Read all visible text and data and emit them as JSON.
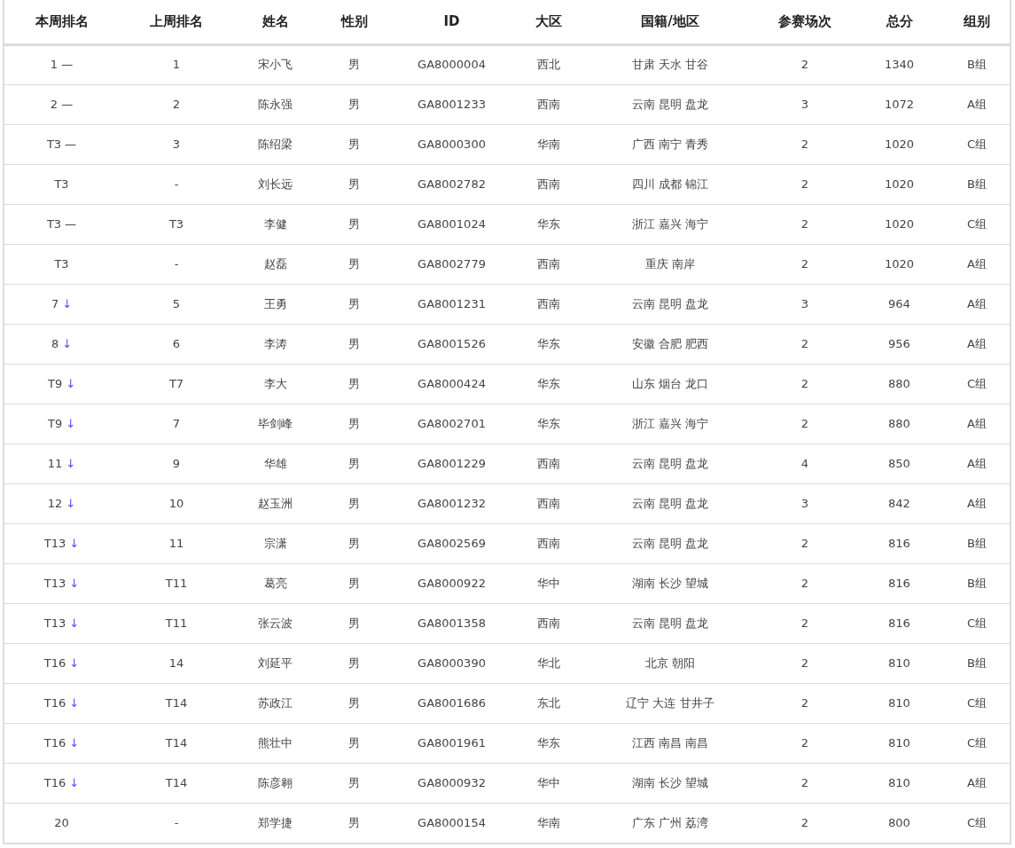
{
  "table": {
    "columns": [
      "本周排名",
      "上周排名",
      "姓名",
      "性别",
      "ID",
      "大区",
      "国籍/地区",
      "参赛场次",
      "总分",
      "组别"
    ],
    "rows": [
      {
        "rank": "1",
        "kind": "same",
        "trend": "—",
        "last_rank": "1",
        "name": "宋小飞",
        "gender": "男",
        "id": "GA8000004",
        "region": "西北",
        "area": "甘肃 天水 甘谷",
        "matches": "2",
        "score": "1340",
        "group": "B组"
      },
      {
        "rank": "2",
        "kind": "same",
        "trend": "—",
        "last_rank": "2",
        "name": "陈永强",
        "gender": "男",
        "id": "GA8001233",
        "region": "西南",
        "area": "云南 昆明 盘龙",
        "matches": "3",
        "score": "1072",
        "group": "A组"
      },
      {
        "rank": "T3",
        "kind": "same",
        "trend": "—",
        "last_rank": "3",
        "name": "陈绍梁",
        "gender": "男",
        "id": "GA8000300",
        "region": "华南",
        "area": "广西 南宁 青秀",
        "matches": "2",
        "score": "1020",
        "group": "C组"
      },
      {
        "rank": "T3",
        "last_rank": "-",
        "name": "刘长远",
        "gender": "男",
        "id": "GA8002782",
        "region": "西南",
        "area": "四川 成都 锦江",
        "matches": "2",
        "score": "1020",
        "group": "B组"
      },
      {
        "rank": "T3",
        "kind": "same",
        "trend": "—",
        "last_rank": "T3",
        "name": "李健",
        "gender": "男",
        "id": "GA8001024",
        "region": "华东",
        "area": "浙江 嘉兴 海宁",
        "matches": "2",
        "score": "1020",
        "group": "C组"
      },
      {
        "rank": "T3",
        "last_rank": "-",
        "name": "赵磊",
        "gender": "男",
        "id": "GA8002779",
        "region": "西南",
        "area": "重庆 南岸",
        "matches": "2",
        "score": "1020",
        "group": "A组"
      },
      {
        "rank": "7",
        "kind": "down",
        "trend": "↓",
        "last_rank": "5",
        "name": "王勇",
        "gender": "男",
        "id": "GA8001231",
        "region": "西南",
        "area": "云南 昆明 盘龙",
        "matches": "3",
        "score": "964",
        "group": "A组"
      },
      {
        "rank": "8",
        "kind": "down",
        "trend": "↓",
        "last_rank": "6",
        "name": "李涛",
        "gender": "男",
        "id": "GA8001526",
        "region": "华东",
        "area": "安徽 合肥 肥西",
        "matches": "2",
        "score": "956",
        "group": "A组"
      },
      {
        "rank": "T9",
        "kind": "down",
        "trend": "↓",
        "last_rank": "T7",
        "name": "李大",
        "gender": "男",
        "id": "GA8000424",
        "region": "华东",
        "area": "山东 烟台 龙口",
        "matches": "2",
        "score": "880",
        "group": "C组"
      },
      {
        "rank": "T9",
        "kind": "down",
        "trend": "↓",
        "last_rank": "7",
        "name": "毕剑峰",
        "gender": "男",
        "id": "GA8002701",
        "region": "华东",
        "area": "浙江 嘉兴 海宁",
        "matches": "2",
        "score": "880",
        "group": "A组"
      },
      {
        "rank": "11",
        "kind": "down",
        "trend": "↓",
        "last_rank": "9",
        "name": "华雄",
        "gender": "男",
        "id": "GA8001229",
        "region": "西南",
        "area": "云南 昆明 盘龙",
        "matches": "4",
        "score": "850",
        "group": "A组"
      },
      {
        "rank": "12",
        "kind": "down",
        "trend": "↓",
        "last_rank": "10",
        "name": "赵玉洲",
        "gender": "男",
        "id": "GA8001232",
        "region": "西南",
        "area": "云南 昆明 盘龙",
        "matches": "3",
        "score": "842",
        "group": "A组"
      },
      {
        "rank": "T13",
        "kind": "down",
        "trend": "↓",
        "last_rank": "11",
        "name": "宗潇",
        "gender": "男",
        "id": "GA8002569",
        "region": "西南",
        "area": "云南 昆明 盘龙",
        "matches": "2",
        "score": "816",
        "group": "B组"
      },
      {
        "rank": "T13",
        "kind": "down",
        "trend": "↓",
        "last_rank": "T11",
        "name": "葛亮",
        "gender": "男",
        "id": "GA8000922",
        "region": "华中",
        "area": "湖南 长沙 望城",
        "matches": "2",
        "score": "816",
        "group": "B组"
      },
      {
        "rank": "T13",
        "kind": "down",
        "trend": "↓",
        "last_rank": "T11",
        "name": "张云波",
        "gender": "男",
        "id": "GA8001358",
        "region": "西南",
        "area": "云南 昆明 盘龙",
        "matches": "2",
        "score": "816",
        "group": "C组"
      },
      {
        "rank": "T16",
        "kind": "down",
        "trend": "↓",
        "last_rank": "14",
        "name": "刘延平",
        "gender": "男",
        "id": "GA8000390",
        "region": "华北",
        "area": "北京 朝阳",
        "matches": "2",
        "score": "810",
        "group": "B组"
      },
      {
        "rank": "T16",
        "kind": "down",
        "trend": "↓",
        "last_rank": "T14",
        "name": "苏政江",
        "gender": "男",
        "id": "GA8001686",
        "region": "东北",
        "area": "辽宁 大连 甘井子",
        "matches": "2",
        "score": "810",
        "group": "C组"
      },
      {
        "rank": "T16",
        "kind": "down",
        "trend": "↓",
        "last_rank": "T14",
        "name": "熊壮中",
        "gender": "男",
        "id": "GA8001961",
        "region": "华东",
        "area": "江西 南昌 南昌",
        "matches": "2",
        "score": "810",
        "group": "C组"
      },
      {
        "rank": "T16",
        "kind": "down",
        "trend": "↓",
        "last_rank": "T14",
        "name": "陈彦翱",
        "gender": "男",
        "id": "GA8000932",
        "region": "华中",
        "area": "湖南 长沙 望城",
        "matches": "2",
        "score": "810",
        "group": "A组"
      },
      {
        "rank": "20",
        "last_rank": "-",
        "name": "郑学捷",
        "gender": "男",
        "id": "GA8000154",
        "region": "华南",
        "area": "广东 广州 荔湾",
        "matches": "2",
        "score": "800",
        "group": "C组"
      }
    ]
  }
}
